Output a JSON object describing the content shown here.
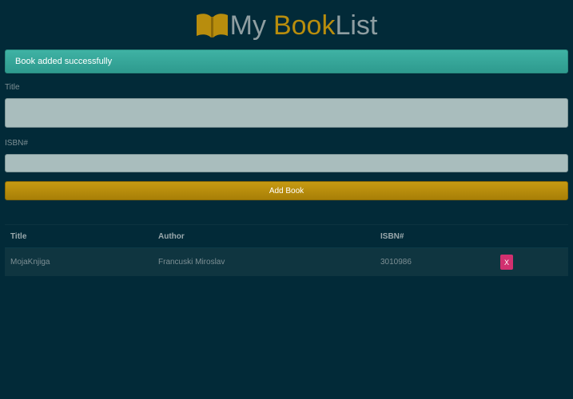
{
  "header": {
    "icon": "open-book-icon",
    "title_part1": "My",
    "title_part2": "Book",
    "title_part3": "List",
    "brand_color": "#b88d0d"
  },
  "alert": {
    "message": "Book added successfully",
    "color": "#3fb2a4"
  },
  "form": {
    "title_label": "Title",
    "title_value": "",
    "isbn_label": "ISBN#",
    "isbn_value": "",
    "submit_label": "Add Book",
    "submit_color": "#b88d0d"
  },
  "table": {
    "headers": {
      "title": "Title",
      "author": "Author",
      "isbn": "ISBN#"
    },
    "rows": [
      {
        "title": "MojaKnjiga",
        "author": "Francuski Miroslav",
        "isbn": "3010986",
        "delete_label": "X",
        "delete_color": "#d1306f"
      }
    ]
  }
}
